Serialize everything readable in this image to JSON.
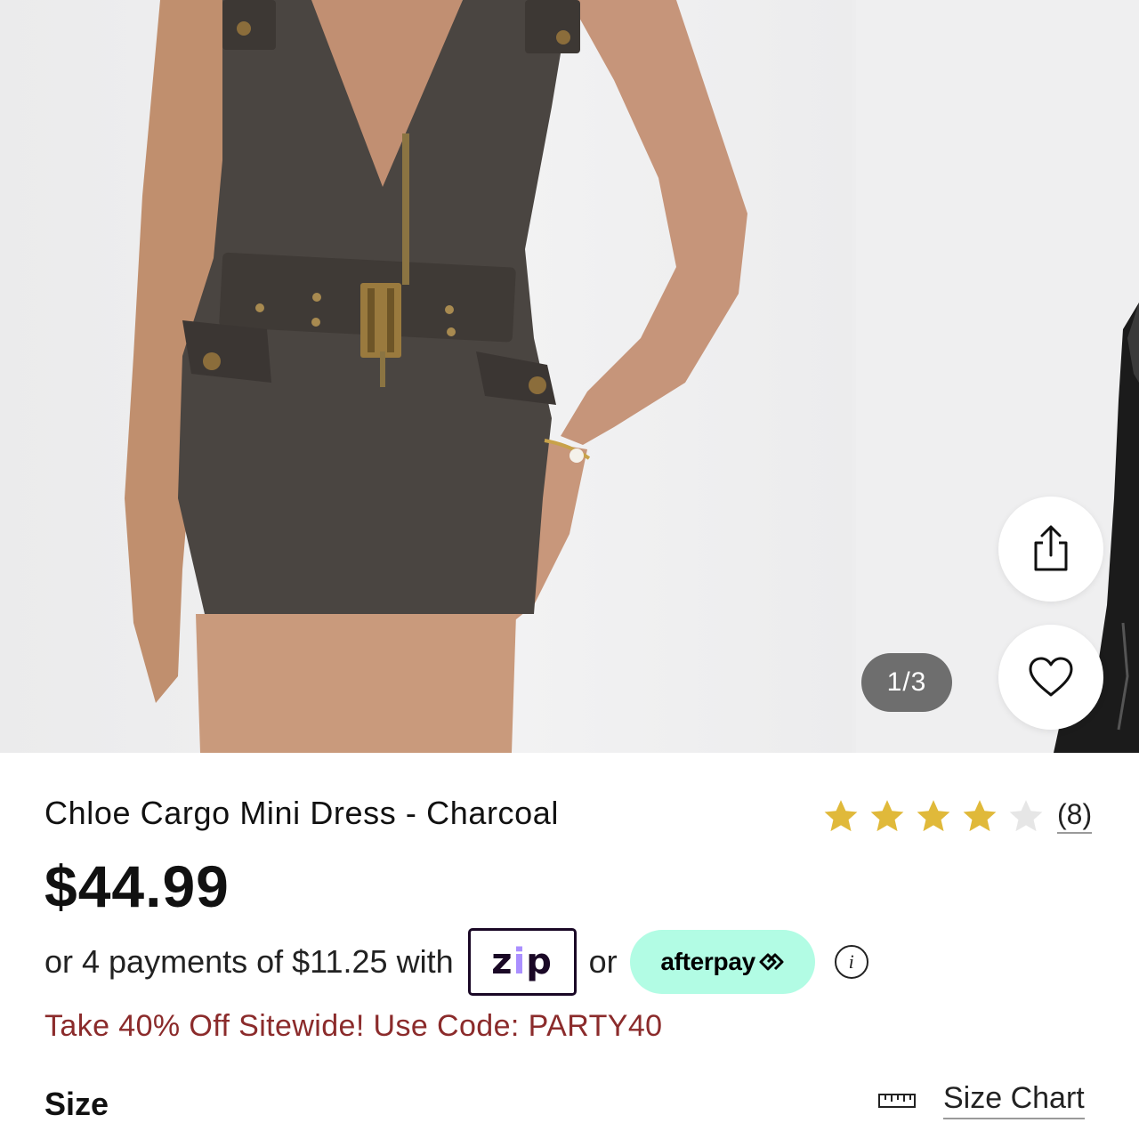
{
  "gallery": {
    "counter": "1/3",
    "share_icon": "share-icon",
    "favorite_icon": "heart-icon"
  },
  "product": {
    "title": "Chloe Cargo Mini Dress - Charcoal",
    "price": "$44.99",
    "rating": {
      "value": 4,
      "max": 5,
      "review_count": "(8)",
      "star_color": "#e0b93a",
      "empty_star_color": "#e6e6e6"
    }
  },
  "payments": {
    "text": "or 4 payments of $11.25 with",
    "zip_label_a": "z",
    "zip_label_b": "i",
    "zip_label_c": "p",
    "or_text": "or",
    "afterpay_label": "afterpay"
  },
  "promo": {
    "text": "Take 40% Off Sitewide! Use Code: PARTY40",
    "color": "#8b2b2b"
  },
  "size": {
    "label": "Size",
    "chart_label": "Size Chart",
    "chart_icon": "ruler-icon"
  }
}
